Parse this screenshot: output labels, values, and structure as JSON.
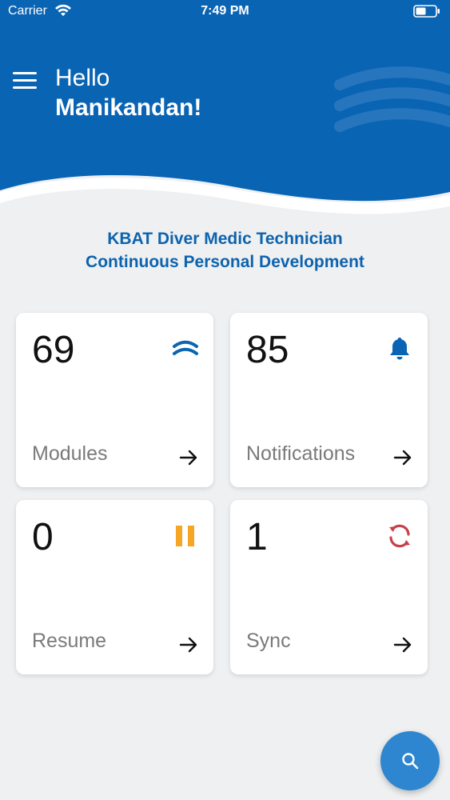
{
  "status_bar": {
    "carrier": "Carrier",
    "time": "7:49 PM"
  },
  "header": {
    "greeting": "Hello",
    "user_name": "Manikandan!"
  },
  "app_title": {
    "line1": "KBAT Diver Medic Technician",
    "line2": "Continuous Personal Development"
  },
  "cards": [
    {
      "count": "69",
      "label": "Modules",
      "icon": "waves-icon"
    },
    {
      "count": "85",
      "label": "Notifications",
      "icon": "bell-icon"
    },
    {
      "count": "0",
      "label": "Resume",
      "icon": "pause-icon"
    },
    {
      "count": "1",
      "label": "Sync",
      "icon": "sync-icon"
    }
  ],
  "colors": {
    "primary": "#0a64b4",
    "title": "#0d63ad",
    "pause": "#f5a623",
    "sync": "#c9404b",
    "fab": "#2e86d0"
  },
  "fab": {
    "icon": "search-icon"
  }
}
